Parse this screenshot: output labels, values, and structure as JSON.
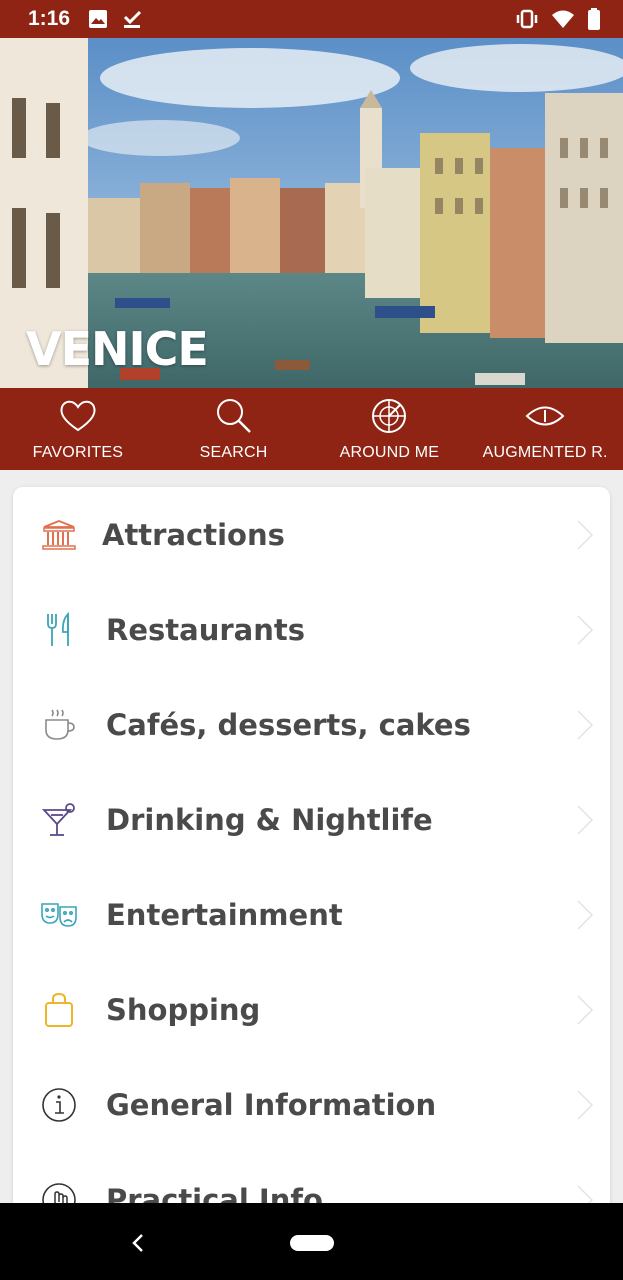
{
  "status_bar": {
    "time": "1:16",
    "left_icons": [
      "image-icon",
      "check-download-icon"
    ],
    "right_icons": [
      "vibrate-icon",
      "wifi-icon",
      "battery-icon"
    ],
    "color": "#8f2414"
  },
  "hero": {
    "title": "VENICE"
  },
  "actions": [
    {
      "label": "FAVORITES",
      "icon": "heart-icon"
    },
    {
      "label": "SEARCH",
      "icon": "search-icon"
    },
    {
      "label": "AROUND ME",
      "icon": "radar-icon"
    },
    {
      "label": "AUGMENTED R.",
      "icon": "eye-icon"
    }
  ],
  "categories": [
    {
      "label": "Attractions",
      "icon": "monument-icon",
      "color": "#e0704e"
    },
    {
      "label": "Restaurants",
      "icon": "fork-knife-icon",
      "color": "#3aa6b9"
    },
    {
      "label": "Cafés, desserts, cakes",
      "icon": "coffee-cup-icon",
      "color": "#8a8a8a"
    },
    {
      "label": "Drinking & Nightlife",
      "icon": "cocktail-icon",
      "color": "#5b4a8a"
    },
    {
      "label": "Entertainment",
      "icon": "theater-masks-icon",
      "color": "#3aa6b9"
    },
    {
      "label": "Shopping",
      "icon": "shopping-bag-icon",
      "color": "#f0b429"
    },
    {
      "label": "General Information",
      "icon": "info-icon",
      "color": "#333333"
    },
    {
      "label": "Practical Info",
      "icon": "hand-icon",
      "color": "#333333"
    }
  ],
  "nav": {
    "back_icon": "back-chevron-icon",
    "home_icon": "home-pill-icon"
  }
}
